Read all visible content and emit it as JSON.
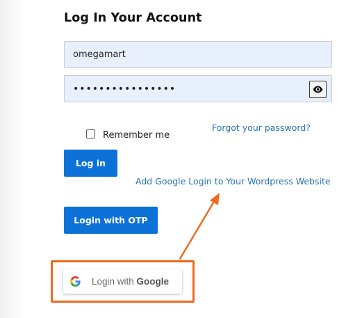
{
  "form": {
    "title": "Log In Your Account",
    "username_value": "omegamart",
    "password_value": "••••••••••••••••",
    "remember_label": "Remember me",
    "forgot_label": "Forgot your password?",
    "login_label": "Log in",
    "otp_label": "Login with OTP"
  },
  "google": {
    "prefix": "Login with ",
    "brand": "Google",
    "icon": "google-g-icon"
  },
  "annotation": {
    "text": "Add Google Login to Your Wordpress Website",
    "highlight_color": "#ef6a1f"
  },
  "colors": {
    "primary_button": "#0c72d8",
    "link": "#2872b5",
    "input_background": "#e8f0fe"
  },
  "icons": {
    "password_toggle": "eye-icon"
  }
}
